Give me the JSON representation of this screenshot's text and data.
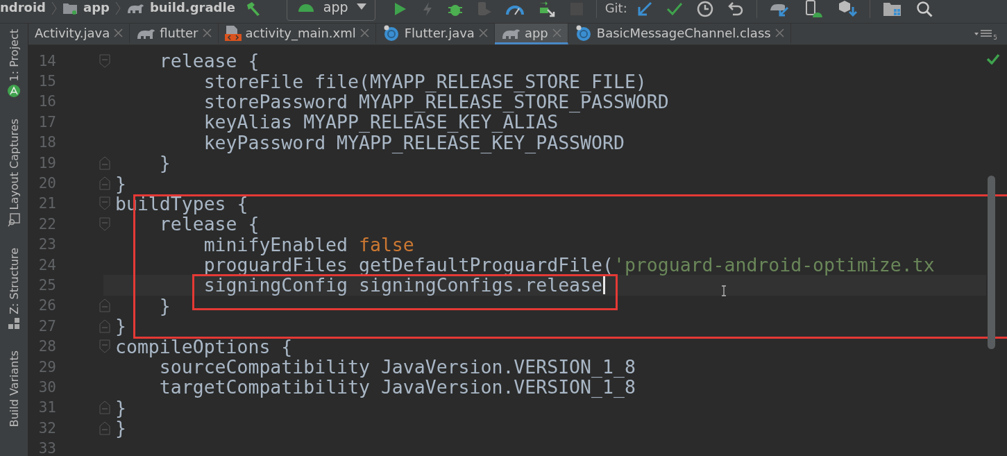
{
  "breadcrumbs": [
    {
      "label": "ndroid"
    },
    {
      "label": "app"
    },
    {
      "label": "build.gradle"
    }
  ],
  "run_config": {
    "label": "app"
  },
  "git": {
    "label": "Git:"
  },
  "tabs": [
    {
      "label": "Activity.java",
      "selected": false
    },
    {
      "label": "flutter",
      "selected": false
    },
    {
      "label": "activity_main.xml",
      "selected": false
    },
    {
      "label": "Flutter.java",
      "selected": false
    },
    {
      "label": "app",
      "selected": true
    },
    {
      "label": "BasicMessageChannel.class",
      "selected": false
    }
  ],
  "tab_count": "5",
  "tool_windows": [
    {
      "label": "1: Project"
    },
    {
      "label": "Layout Captures"
    },
    {
      "label": "Z: Structure"
    },
    {
      "label": "Build Variants"
    }
  ],
  "code": {
    "lines": [
      {
        "number": "14",
        "tokens": [
          {
            "t": "    release {",
            "kind": "plain"
          }
        ]
      },
      {
        "number": "15",
        "tokens": [
          {
            "t": "        storeFile file(MYAPP_RELEASE_STORE_FILE)",
            "kind": "plain"
          }
        ]
      },
      {
        "number": "16",
        "tokens": [
          {
            "t": "        storePassword MYAPP_RELEASE_STORE_PASSWORD",
            "kind": "plain"
          }
        ]
      },
      {
        "number": "17",
        "tokens": [
          {
            "t": "        keyAlias MYAPP_RELEASE_KEY_ALIAS",
            "kind": "plain"
          }
        ]
      },
      {
        "number": "18",
        "tokens": [
          {
            "t": "        keyPassword MYAPP_RELEASE_KEY_PASSWORD",
            "kind": "plain"
          }
        ]
      },
      {
        "number": "19",
        "tokens": [
          {
            "t": "    }",
            "kind": "plain"
          }
        ]
      },
      {
        "number": "20",
        "tokens": [
          {
            "t": "}",
            "kind": "plain"
          }
        ]
      },
      {
        "number": "21",
        "tokens": [
          {
            "t": "buildTypes {",
            "kind": "plain"
          }
        ]
      },
      {
        "number": "22",
        "tokens": [
          {
            "t": "    release {",
            "kind": "plain"
          }
        ]
      },
      {
        "number": "23",
        "tokens": [
          {
            "t": "        minifyEnabled ",
            "kind": "plain"
          },
          {
            "t": "false",
            "kind": "keyword"
          }
        ]
      },
      {
        "number": "24",
        "tokens": [
          {
            "t": "        proguardFiles getDefaultProguardFile(",
            "kind": "plain"
          },
          {
            "t": "'proguard-android-optimize.tx",
            "kind": "string"
          }
        ]
      },
      {
        "number": "25",
        "cursor": true,
        "tokens": [
          {
            "t": "        signingConfig signingConfigs.release",
            "kind": "plain"
          }
        ]
      },
      {
        "number": "26",
        "tokens": [
          {
            "t": "    }",
            "kind": "plain"
          }
        ]
      },
      {
        "number": "27",
        "tokens": [
          {
            "t": "}",
            "kind": "plain"
          }
        ]
      },
      {
        "number": "28",
        "tokens": [
          {
            "t": "compileOptions {",
            "kind": "plain"
          }
        ]
      },
      {
        "number": "29",
        "tokens": [
          {
            "t": "    sourceCompatibility JavaVersion.VERSION_1_8",
            "kind": "plain"
          }
        ]
      },
      {
        "number": "30",
        "tokens": [
          {
            "t": "    targetCompatibility JavaVersion.VERSION_1_8",
            "kind": "plain"
          }
        ]
      },
      {
        "number": "31",
        "tokens": [
          {
            "t": "}",
            "kind": "plain"
          }
        ]
      },
      {
        "number": "32",
        "tokens": [
          {
            "t": "}",
            "kind": "plain"
          }
        ]
      },
      {
        "number": "33"
      }
    ]
  },
  "annotations": [
    {
      "kind": "rectangle"
    },
    {
      "kind": "rectangle"
    }
  ],
  "inspection_ok": true
}
